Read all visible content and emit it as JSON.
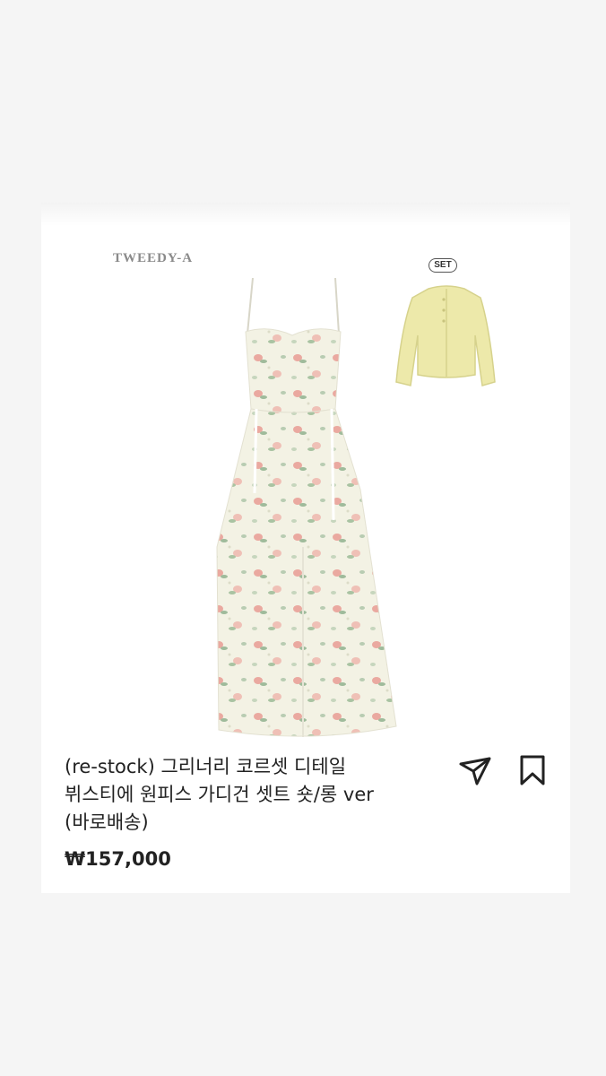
{
  "product": {
    "brand": "TWEEDY-A",
    "set_badge": "SET",
    "title": "(re-stock) 그리너리 코르셋 디테일\n뷔스티에 원피스 가디건 셋트 숏/롱 ver\n(바로배송)",
    "price": "₩157,000"
  },
  "icons": {
    "share": "paper-plane-icon",
    "bookmark": "bookmark-icon"
  },
  "colors": {
    "background": "#f5f5f5",
    "card": "#ffffff",
    "dress_base": "#f2f1e3",
    "flower_pink": "#e9a9a1",
    "leaf_green": "#9db89a",
    "cardigan": "#ece8a8"
  }
}
